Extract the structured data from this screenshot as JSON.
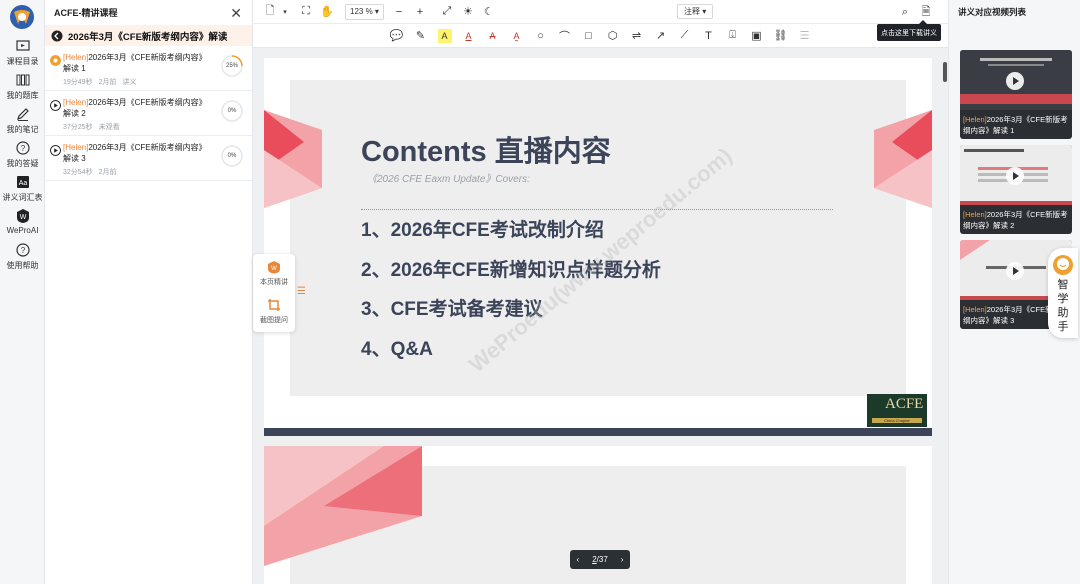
{
  "rail": {
    "items": [
      {
        "label": "课程目录",
        "icon": "course-catalog-icon"
      },
      {
        "label": "我的题库",
        "icon": "question-bank-icon"
      },
      {
        "label": "我的笔记",
        "icon": "notes-icon"
      },
      {
        "label": "我的答疑",
        "icon": "qa-icon"
      },
      {
        "label": "讲义词汇表",
        "icon": "glossary-icon"
      },
      {
        "label": "WeProAI",
        "icon": "weproai-icon"
      },
      {
        "label": "使用帮助",
        "icon": "help-icon"
      }
    ]
  },
  "course_panel": {
    "title": "ACFE-精讲课程",
    "section": "2026年3月《CFE新版考纲内容》解读",
    "lessons": [
      {
        "who": "[Helen]",
        "title": "2026年3月《CFE新版考纲内容》解读 1",
        "duration": "19分49秒",
        "ago": "2月前",
        "tag": "讲义",
        "progress": "25%",
        "progress_value": 25
      },
      {
        "who": "[Helen]",
        "title": "2026年3月《CFE新版考纲内容》解读 2",
        "duration": "37分25秒",
        "ago": "未观看",
        "tag": "",
        "progress": "0%",
        "progress_value": 0
      },
      {
        "who": "[Helen]",
        "title": "2026年3月《CFE新版考纲内容》解读 3",
        "duration": "32分54秒",
        "ago": "2月前",
        "tag": "",
        "progress": "0%",
        "progress_value": 0
      }
    ]
  },
  "toolbar": {
    "zoom": "123 % ▾",
    "annotate": "注释 ▾",
    "tooltip": "点击这里下载讲义"
  },
  "slide": {
    "title": "Contents 直播内容",
    "subtitle": "《2026 CFE Eaxm Update》Covers:",
    "items": [
      "1、2026年CFE考试改制介绍",
      "2、2026年CFE新增知识点样题分析",
      "3、CFE考试备考建议",
      "4、Q&A"
    ],
    "logo_text": "ACFE",
    "logo_band": "China Chapter",
    "watermark": "WeProedu(www.weproedu.com)"
  },
  "pager": {
    "current": "2",
    "total": "/37"
  },
  "float_tools": {
    "page_lecture": "本页精讲",
    "screenshot_ask": "截图提问"
  },
  "right_panel": {
    "title": "讲义对应视频列表",
    "videos": [
      {
        "who": "[Helen]",
        "title": "2026年3月《CFE新版考纲内容》解读 1"
      },
      {
        "who": "[Helen]",
        "title": "2026年3月《CFE新版考纲内容》解读 2"
      },
      {
        "who": "[Helen]",
        "title": "2026年3月《CFE新版考纲内容》解读 3"
      }
    ]
  },
  "assistant": {
    "label": "智学助手"
  },
  "colors": {
    "accent": "#e8873a",
    "slide_text": "#3b4458",
    "video_caption_who": "#f2a14a"
  }
}
